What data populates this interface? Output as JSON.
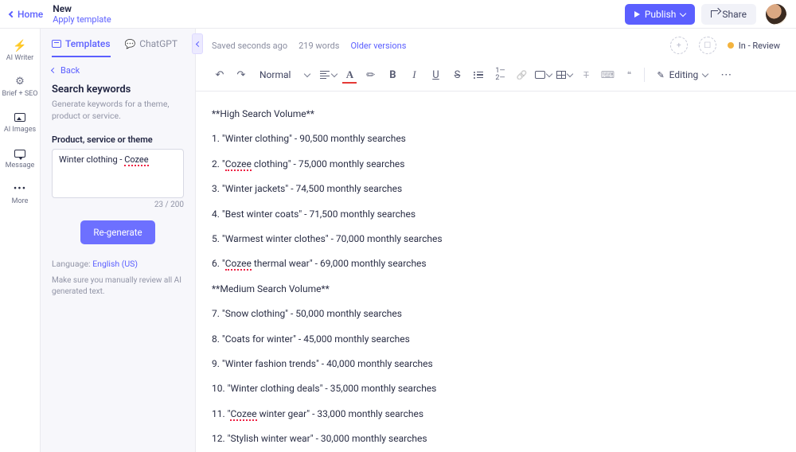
{
  "header": {
    "home": "Home",
    "title": "New",
    "apply_template": "Apply template",
    "publish": "Publish",
    "share": "Share"
  },
  "rail": {
    "ai_writer": "AI Writer",
    "brief_seo": "Brief + SEO",
    "ai_images": "AI Images",
    "message": "Message",
    "more": "More"
  },
  "side": {
    "tab_templates": "Templates",
    "tab_chatgpt": "ChatGPT",
    "back": "Back",
    "title": "Search keywords",
    "desc": "Generate keywords for a theme, product or service.",
    "field_label": "Product, service or theme",
    "field_value": "Winter clothing - Cozee",
    "counter": "23 / 200",
    "regenerate": "Re-generate",
    "lang_prefix": "Language: ",
    "lang_value": "English (US)",
    "note": "Make sure you manually review all AI generated text."
  },
  "meta": {
    "saved": "Saved seconds ago",
    "words": "219 words",
    "older": "Older versions",
    "status": "In - Review"
  },
  "toolbar": {
    "heading": "Normal",
    "mode": "Editing"
  },
  "doc": {
    "lines": [
      "**High Search Volume**",
      "1. \"Winter clothing\" - 90,500 monthly searches",
      "2. \"Cozee clothing\" - 75,000 monthly searches",
      "3. \"Winter jackets\" - 74,500 monthly searches",
      "4. \"Best winter coats\" - 71,500 monthly searches",
      "5. \"Warmest winter clothes\" - 70,000 monthly searches",
      "6. \"Cozee thermal wear\" - 69,000 monthly searches",
      "**Medium Search Volume**",
      "7. \"Snow clothing\" - 50,000 monthly searches",
      "8. \"Coats for winter\" - 45,000 monthly searches",
      "9. \"Winter fashion trends\" - 40,000 monthly searches",
      "10.  \"Winter clothing deals\" - 35,000 monthly searches",
      "11. \"Cozee winter gear\" - 33,000 monthly searches",
      "12. \"Stylish winter wear\" - 30,000 monthly searches"
    ]
  }
}
